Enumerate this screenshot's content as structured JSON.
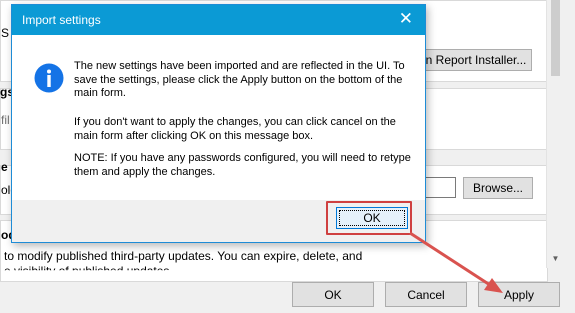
{
  "dialog": {
    "title": "Import settings",
    "close_glyph": "✕",
    "icon": "info-icon",
    "paragraphs": [
      "The new settings have been imported and are reflected in the UI. To save the settings, please click the Apply button on the bottom of the main form.",
      "If you don't want to apply the changes, you can click cancel on the main form after clicking OK on this message box.",
      "NOTE: If you have any passwords configured, you will need to retype them and apply the changes."
    ],
    "ok_label": "OK"
  },
  "main_form": {
    "report_installer_button": "n Report Installer...",
    "browse_button": "Browse...",
    "fragments": {
      "s_top": "S",
      "gs": "gs",
      "fil": "fil",
      "e_a": "e a",
      "old": "old",
      "od": "od"
    },
    "description_line1": "to modify published third-party updates. You can expire, delete, and",
    "description_line2": "e visibility of published updates.",
    "buttons": {
      "ok": "OK",
      "cancel": "Cancel",
      "apply": "Apply"
    }
  },
  "colors": {
    "title_bar": "#0b9ad5",
    "highlight": "#cf4040",
    "arrow": "#d9534f"
  }
}
